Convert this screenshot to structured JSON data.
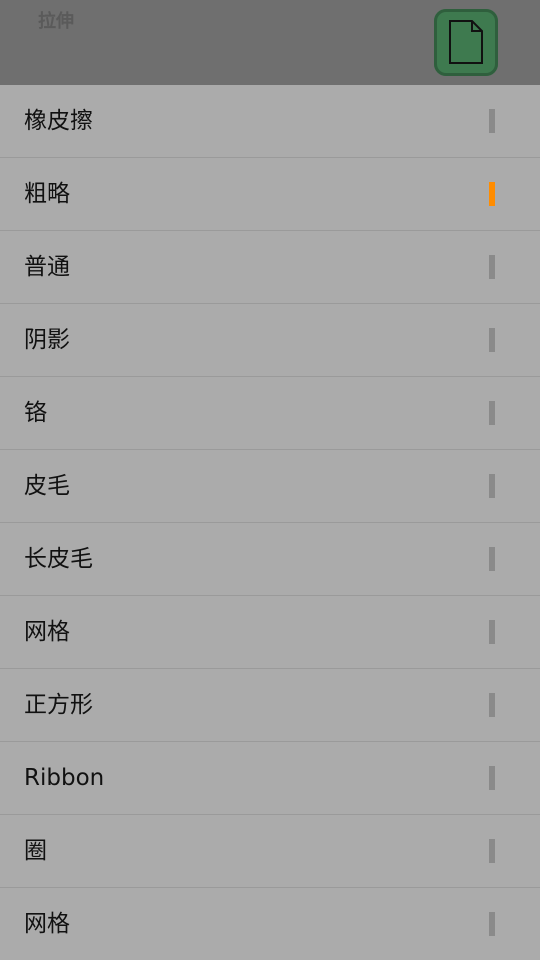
{
  "header": {
    "title": "拉伸",
    "doc_icon": "document-icon",
    "doc_button_color": "#3e7a4f"
  },
  "colors": {
    "selected_indicator": "#ff8c00",
    "unselected_indicator": "#8a8a8a"
  },
  "menu": {
    "items": [
      {
        "label": "橡皮擦",
        "selected": false
      },
      {
        "label": "粗略",
        "selected": true
      },
      {
        "label": "普通",
        "selected": false
      },
      {
        "label": "阴影",
        "selected": false
      },
      {
        "label": "铬",
        "selected": false
      },
      {
        "label": "皮毛",
        "selected": false
      },
      {
        "label": "长皮毛",
        "selected": false
      },
      {
        "label": "网格",
        "selected": false
      },
      {
        "label": "正方形",
        "selected": false
      },
      {
        "label": "Ribbon",
        "selected": false
      },
      {
        "label": "圈",
        "selected": false
      },
      {
        "label": "网格",
        "selected": false
      }
    ]
  }
}
